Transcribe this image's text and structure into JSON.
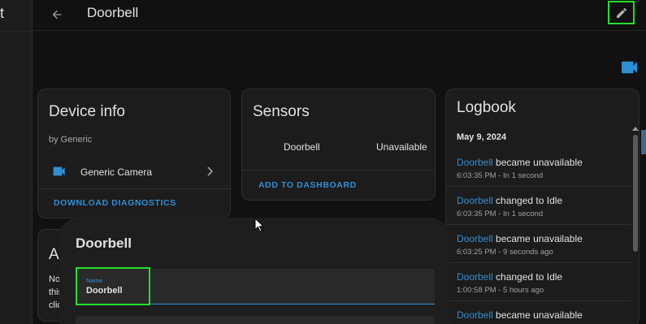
{
  "sidebar": {
    "clipped_text": "t"
  },
  "header": {
    "title": "Doorbell",
    "back_icon": "arrow-left-icon",
    "edit_icon": "pencil-icon"
  },
  "colors": {
    "accent": "#2f8fd6",
    "highlight": "#22e02a",
    "background": "#111111",
    "card": "#1c1c1c"
  },
  "device_info": {
    "title": "Device info",
    "manufacturer": "by Generic",
    "camera_label": "Generic Camera",
    "download_label": "DOWNLOAD DIAGNOSTICS"
  },
  "automations": {
    "title": "Au",
    "text_lines": [
      "No",
      "this",
      "clic"
    ]
  },
  "sensors": {
    "title": "Sensors",
    "entity_name": "Doorbell",
    "entity_state": "Unavailable",
    "add_label": "ADD TO DASHBOARD"
  },
  "logbook": {
    "title": "Logbook",
    "date": "May 9, 2024",
    "entries": [
      {
        "entity": "Doorbell",
        "action": " became unavailable",
        "time": "6:03:35 PM - In 1 second"
      },
      {
        "entity": "Doorbell",
        "action": " changed to Idle",
        "time": "6:03:35 PM - In 1 second"
      },
      {
        "entity": "Doorbell",
        "action": " became unavailable",
        "time": "6:03:25 PM - 9 seconds ago"
      },
      {
        "entity": "Doorbell",
        "action": " changed to Idle",
        "time": "1:00:58 PM - 5 hours ago"
      },
      {
        "entity": "Doorbell",
        "action": " became unavailable",
        "time": ""
      }
    ]
  },
  "dialog": {
    "title": "Doorbell",
    "name_label": "Name",
    "name_value": "Doorbell"
  }
}
